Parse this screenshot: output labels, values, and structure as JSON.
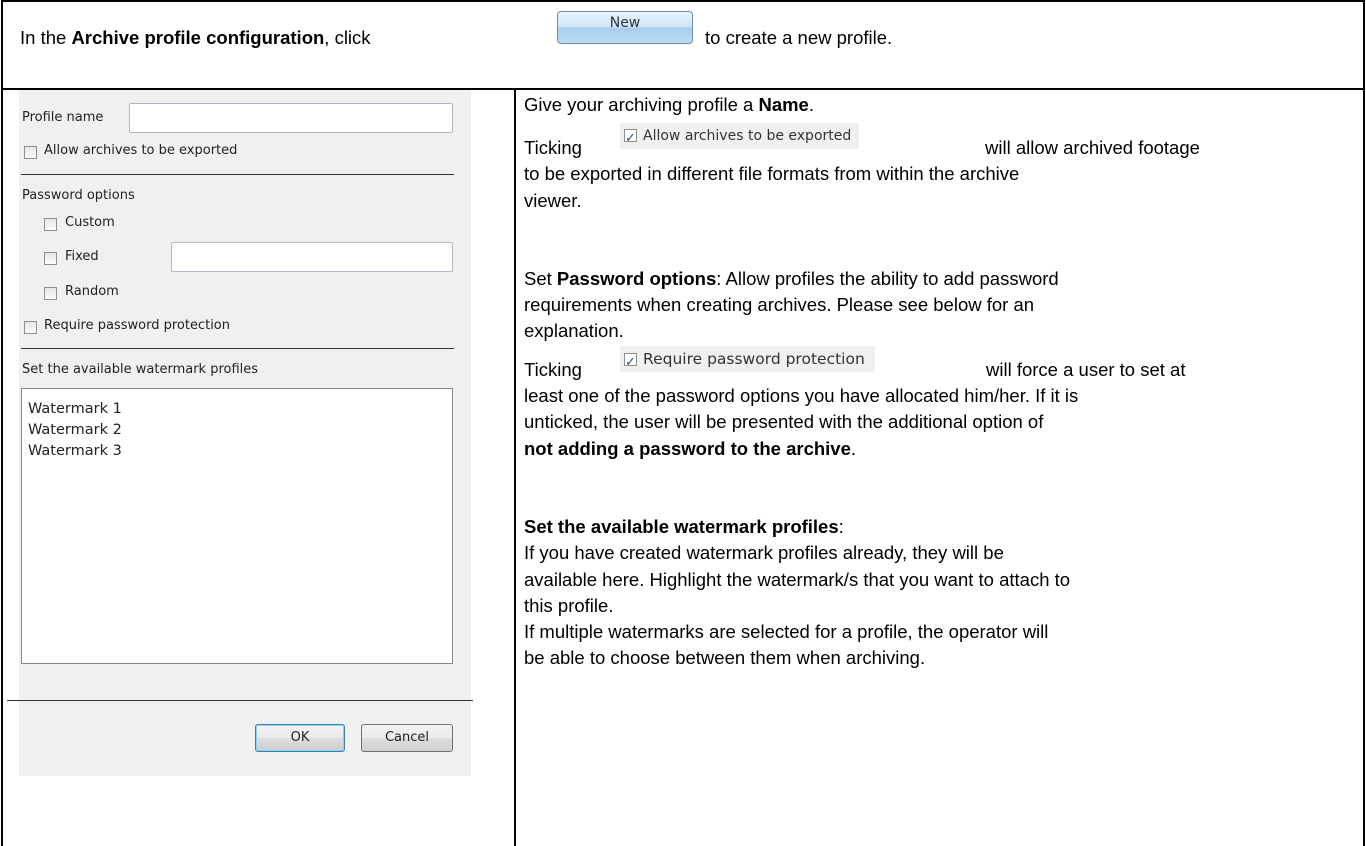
{
  "header": {
    "text_before": "In the ",
    "bold": "Archive profile configuration",
    "text_after_bold": ", click",
    "new_button_label": "New",
    "text_after_button": "to create a new profile."
  },
  "dialog": {
    "profile_name_label": "Profile name",
    "profile_name_value": "",
    "allow_export_label": "Allow archives to be exported",
    "password_options_label": "Password options",
    "custom_label": "Custom",
    "fixed_label": "Fixed",
    "fixed_value": "",
    "random_label": "Random",
    "require_password_label": "Require password protection",
    "watermark_section_label": "Set the available watermark profiles",
    "watermarks": [
      "Watermark 1",
      "Watermark 2",
      "Watermark 3"
    ],
    "ok_label": "OK",
    "cancel_label": "Cancel"
  },
  "explanation": {
    "name_pre": "Give your archiving profile a ",
    "name_bold": "Name",
    "name_post": ".",
    "tick_word": "Ticking",
    "allow_chip": "Allow archives to be exported",
    "allow_post": "will   allow   archived footage",
    "allow_line2": "to be exported in different file formats from within the archive",
    "allow_line3": "viewer.",
    "pw_pre": "Set ",
    "pw_bold": "Password options",
    "pw_post": ": Allow profiles the ability to add password",
    "pw_line2": "requirements when creating archives. Please see below for an",
    "pw_line3": "explanation.",
    "req_chip": "Require password protection",
    "req_post": "will force a user to set at",
    "req_line2": "least one of the password options you have allocated him/her. If it is",
    "req_line3": "unticked, the user will be presented with the additional option of",
    "req_line4_bold": "not adding a password to the archive",
    "req_line4_post": ".",
    "wm_bold": "Set the available watermark profiles",
    "wm_post": ":",
    "wm_line2": "If you have created watermark profiles already, they will be",
    "wm_line3": "available here. Highlight the watermark/s that you want to attach to",
    "wm_line4": "this profile.",
    "wm_line5": "If multiple watermarks are selected for a profile, the operator will",
    "wm_line6": "be able to choose between them when archiving."
  }
}
